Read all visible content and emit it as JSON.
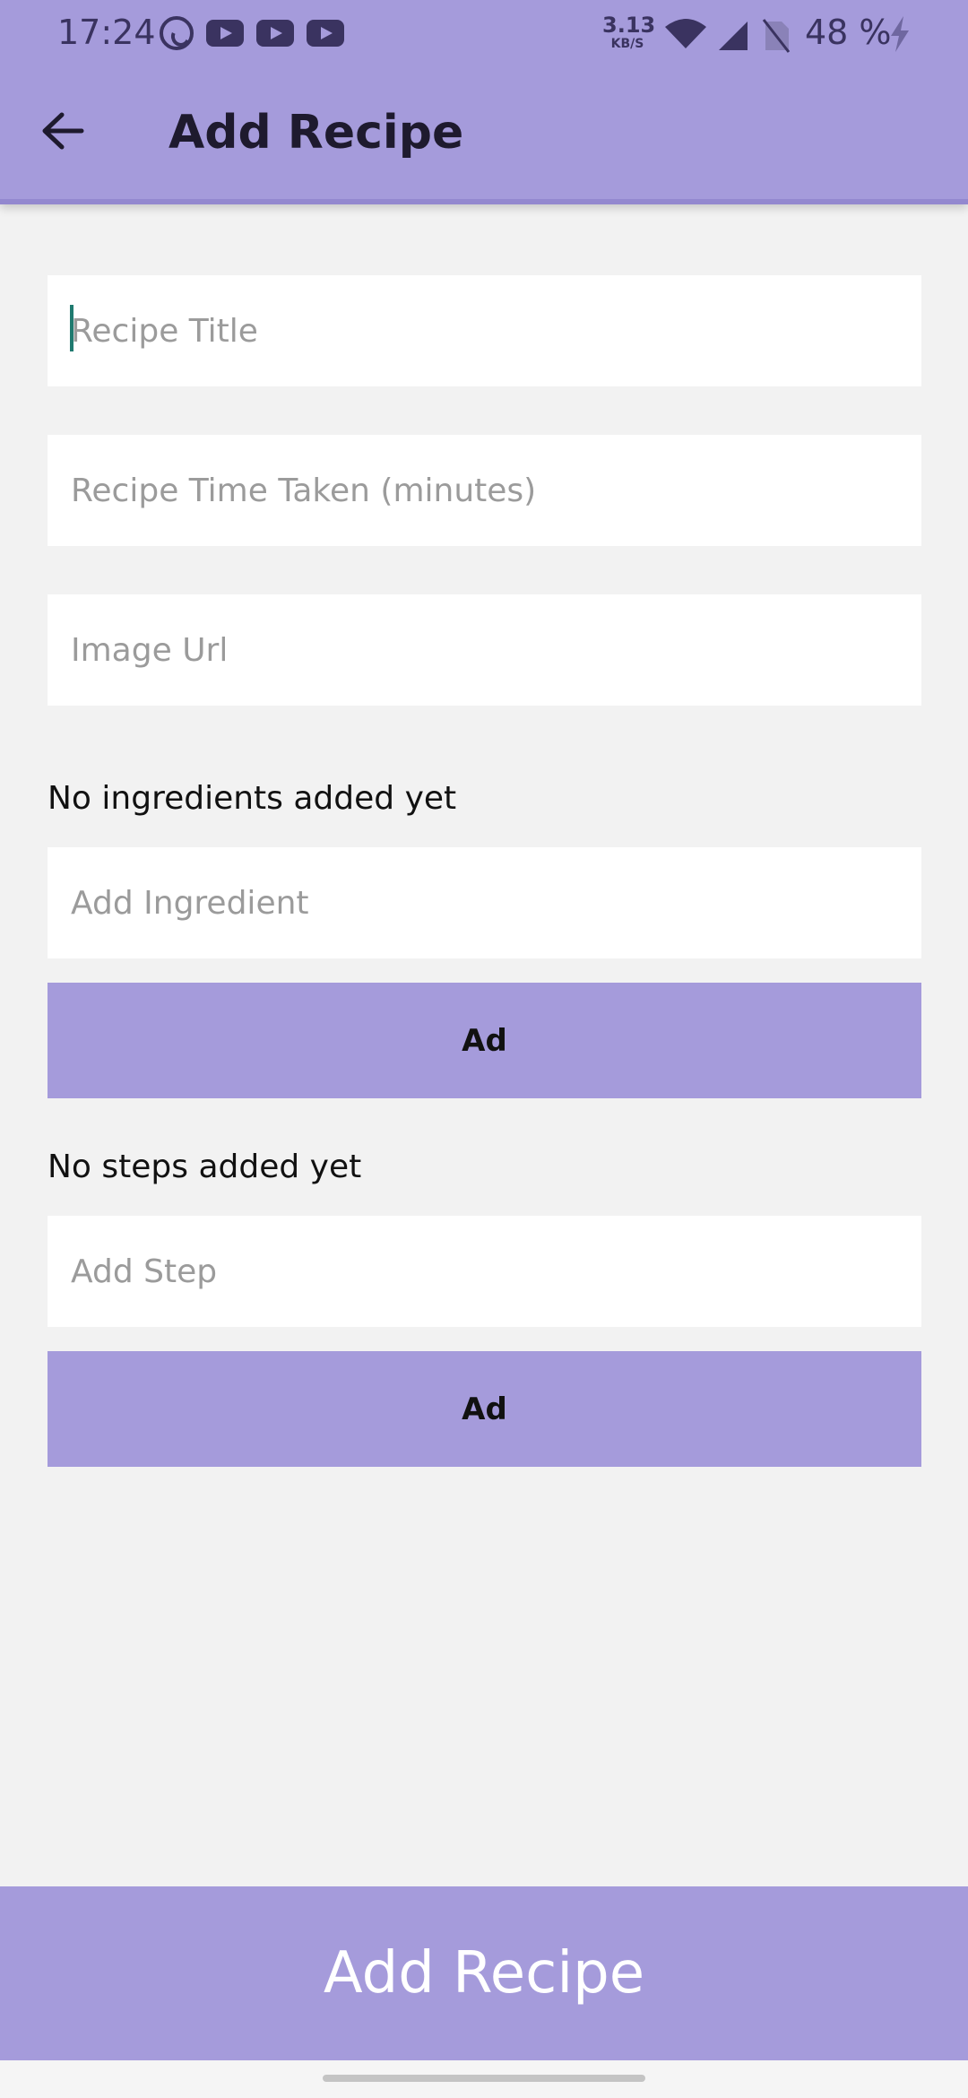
{
  "status_bar": {
    "time": "17:24",
    "net_speed_value": "3.13",
    "net_speed_unit": "KB/S",
    "battery": "48 %",
    "icons": [
      "whatsapp-icon",
      "youtube-icon",
      "youtube-icon",
      "youtube-icon",
      "wifi-icon",
      "cell-signal-icon",
      "no-sim-icon",
      "charging-icon"
    ]
  },
  "toolbar": {
    "title": "Add Recipe",
    "back_icon": "arrow-left-icon"
  },
  "form": {
    "title_placeholder": "Recipe Title",
    "time_placeholder": "Recipe Time Taken (minutes)",
    "image_placeholder": "Image Url",
    "ingredients_status": "No ingredients added yet",
    "ingredient_placeholder": "Add Ingredient",
    "ingredient_add_label": "Ad",
    "steps_status": "No steps added yet",
    "step_placeholder": "Add Step",
    "step_add_label": "Ad"
  },
  "submit": {
    "label": "Add Recipe"
  },
  "colors": {
    "primary": "#a59bdb",
    "background": "#f2f2f2",
    "caret": "#1f7a6f"
  }
}
